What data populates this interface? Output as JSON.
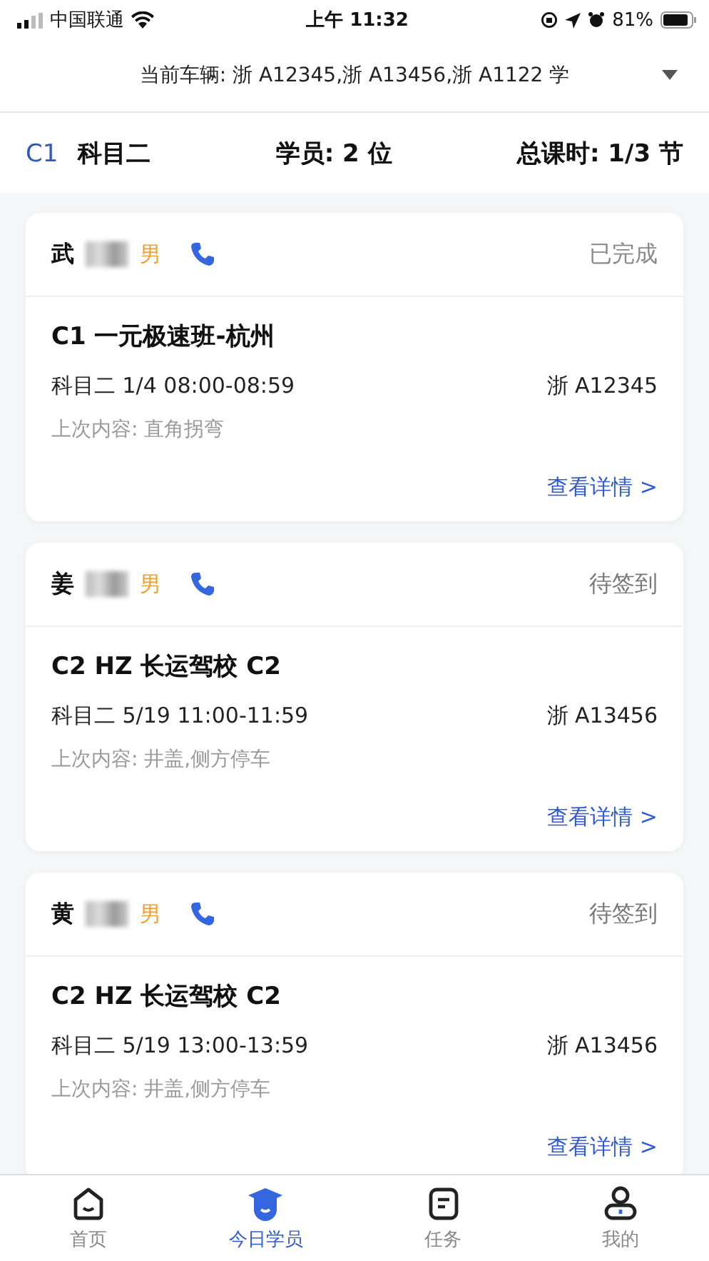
{
  "status_bar": {
    "carrier": "中国联通",
    "time": "上午 11:32",
    "battery": "81%"
  },
  "vehicle_bar": {
    "label": "当前车辆: 浙 A12345,浙 A13456,浙 A1122 学"
  },
  "summary": {
    "license": "C1",
    "subject": "科目二",
    "students": "学员: 2 位",
    "hours": "总课时: 1/3 节"
  },
  "cards": [
    {
      "name": "武",
      "gender": "男",
      "status": "已完成",
      "done": true,
      "course": "C1 一元极速班-杭州",
      "schedule": "科目二 1/4 08:00-08:59",
      "plate": "浙 A12345",
      "last": "上次内容: 直角拐弯",
      "link": "查看详情 >"
    },
    {
      "name": "姜",
      "gender": "男",
      "status": "待签到",
      "done": false,
      "course": "C2 HZ 长运驾校 C2",
      "schedule": "科目二 5/19 11:00-11:59",
      "plate": "浙 A13456",
      "last": "上次内容: 井盖,侧方停车",
      "link": "查看详情 >"
    },
    {
      "name": "黄",
      "gender": "男",
      "status": "待签到",
      "done": false,
      "course": "C2 HZ 长运驾校 C2",
      "schedule": "科目二 5/19 13:00-13:59",
      "plate": "浙 A13456",
      "last": "上次内容: 井盖,侧方停车",
      "link": "查看详情 >"
    }
  ],
  "tabs": [
    {
      "label": "首页",
      "kind": "home",
      "selected": false
    },
    {
      "label": "今日学员",
      "kind": "students",
      "selected": true
    },
    {
      "label": "任务",
      "kind": "tasks",
      "selected": false
    },
    {
      "label": "我的",
      "kind": "me",
      "selected": false
    }
  ]
}
